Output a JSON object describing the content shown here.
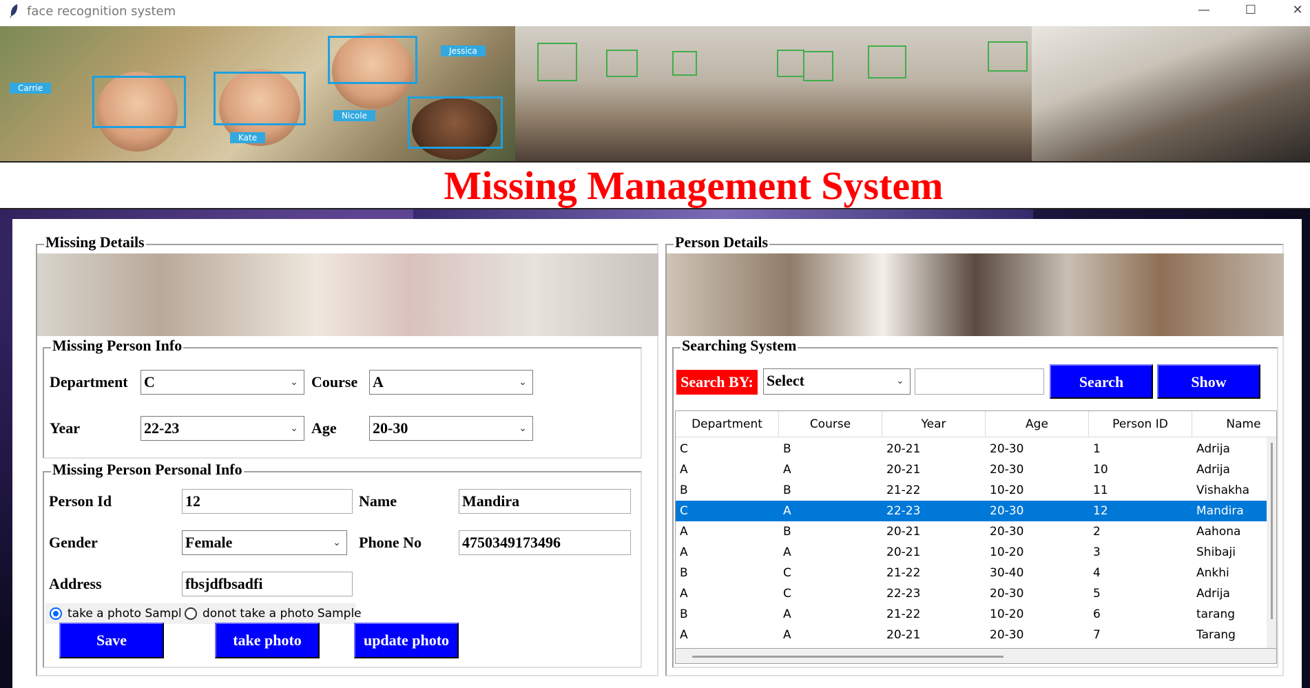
{
  "window": {
    "title": "face recognition system",
    "controls": {
      "minimize": "—",
      "maximize": "☐",
      "close": "✕"
    }
  },
  "banner": {
    "tags": [
      "Carrie",
      "Kate",
      "Nicole",
      "Jessica"
    ]
  },
  "header": {
    "title": "Missing Management System"
  },
  "missing_details": {
    "title": "Missing Details",
    "person_info": {
      "title": "Missing Person Info",
      "department_label": "Department",
      "department_value": "C",
      "course_label": "Course",
      "course_value": "A",
      "year_label": "Year",
      "year_value": "22-23",
      "age_label": "Age",
      "age_value": "20-30"
    },
    "personal_info": {
      "title": "Missing Person Personal Info",
      "person_id_label": "Person Id",
      "person_id_value": "12",
      "name_label": "Name",
      "name_value": "Mandira",
      "gender_label": "Gender",
      "gender_value": "Female",
      "phone_label": "Phone No",
      "phone_value": "4750349173496",
      "address_label": "Address",
      "address_value": "fbsjdfbsadfi",
      "radio_take": "take a photo Sample",
      "radio_donot": "donot take a photo Sample",
      "selected_radio": "take a photo Sample"
    },
    "buttons": {
      "save": "Save",
      "take_photo": "take photo",
      "update_photo": "update photo"
    }
  },
  "person_details": {
    "title": "Person Details",
    "searching": {
      "title": "Searching System",
      "search_by_label": "Search BY:",
      "search_by_value": "Select",
      "search_text": "",
      "search_button": "Search",
      "show_button": "Show"
    },
    "table": {
      "columns": [
        "Department",
        "Course",
        "Year",
        "Age",
        "Person ID",
        "Name"
      ],
      "rows": [
        [
          "C",
          "B",
          "20-21",
          "20-30",
          "1",
          "Adrija"
        ],
        [
          "A",
          "A",
          "20-21",
          "20-30",
          "10",
          "Adrija"
        ],
        [
          "B",
          "B",
          "21-22",
          "10-20",
          "11",
          "Vishakha"
        ],
        [
          "C",
          "A",
          "22-23",
          "20-30",
          "12",
          "Mandira"
        ],
        [
          "A",
          "B",
          "20-21",
          "20-30",
          "2",
          "Aahona"
        ],
        [
          "A",
          "A",
          "20-21",
          "10-20",
          "3",
          "Shibaji"
        ],
        [
          "B",
          "C",
          "21-22",
          "30-40",
          "4",
          "Ankhi"
        ],
        [
          "A",
          "C",
          "22-23",
          "20-30",
          "5",
          "Adrija"
        ],
        [
          "B",
          "A",
          "21-22",
          "10-20",
          "6",
          "tarang"
        ],
        [
          "A",
          "A",
          "20-21",
          "20-30",
          "7",
          "Tarang"
        ]
      ],
      "selected_row": 3
    }
  },
  "colors": {
    "title_red": "#ff0000",
    "button_blue": "#0000ff",
    "selection_blue": "#0078d7",
    "search_label_red": "#ff0000"
  }
}
